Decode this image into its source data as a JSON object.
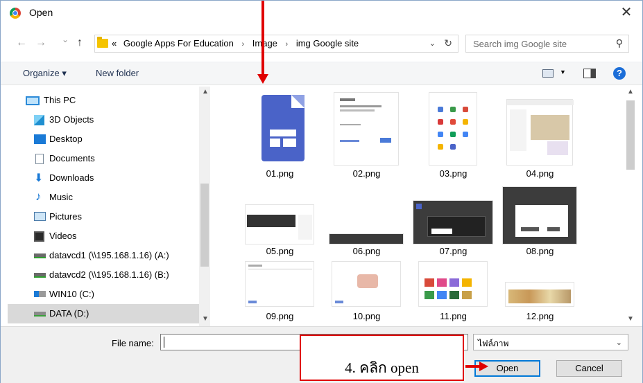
{
  "window": {
    "title": "Open",
    "close_label": "✕"
  },
  "nav": {
    "back": "←",
    "forward": "→",
    "recent": "⌄",
    "up": "↑",
    "breadcrumb": [
      "«",
      "Google Apps For Education",
      "Image",
      "img Google site"
    ],
    "breadcrumb_sep": "›",
    "dropdown": "⌄",
    "refresh": "↻",
    "search_placeholder": "Search img Google site",
    "search_glyph": "⚲"
  },
  "toolbar": {
    "organize": "Organize ▾",
    "new_folder": "New folder",
    "view_caret": "▼",
    "help": "?"
  },
  "sidebar": {
    "items": [
      {
        "label": "This PC",
        "icon": "computer-icon"
      },
      {
        "label": "3D Objects",
        "icon": "cube-icon"
      },
      {
        "label": "Desktop",
        "icon": "desktop-icon"
      },
      {
        "label": "Documents",
        "icon": "documents-icon"
      },
      {
        "label": "Downloads",
        "icon": "downloads-icon"
      },
      {
        "label": "Music",
        "icon": "music-icon"
      },
      {
        "label": "Pictures",
        "icon": "pictures-icon"
      },
      {
        "label": "Videos",
        "icon": "videos-icon"
      },
      {
        "label": "datavcd1 (\\\\195.168.1.16) (A:)",
        "icon": "network-drive-icon"
      },
      {
        "label": "datavcd2 (\\\\195.168.1.16) (B:)",
        "icon": "network-drive-icon"
      },
      {
        "label": "WIN10 (C:)",
        "icon": "system-drive-icon"
      },
      {
        "label": "DATA (D:)",
        "icon": "drive-icon",
        "selected": true
      }
    ]
  },
  "files": [
    {
      "name": "01.png"
    },
    {
      "name": "02.png"
    },
    {
      "name": "03.png"
    },
    {
      "name": "04.png"
    },
    {
      "name": "05.png"
    },
    {
      "name": "06.png"
    },
    {
      "name": "07.png"
    },
    {
      "name": "08.png"
    },
    {
      "name": "09.png"
    },
    {
      "name": "10.png"
    },
    {
      "name": "11.png"
    },
    {
      "name": "12.png"
    }
  ],
  "bottom": {
    "file_name_label": "File name:",
    "file_name_value": "",
    "file_type": "ไฟล์ภาพ",
    "open_label": "Open",
    "cancel_label": "Cancel"
  },
  "annotation": {
    "step_text": "4. คลิก open"
  },
  "colors": {
    "annotation": "#e00000",
    "accent": "#0078d7",
    "sites_blue": "#4a63c8"
  }
}
